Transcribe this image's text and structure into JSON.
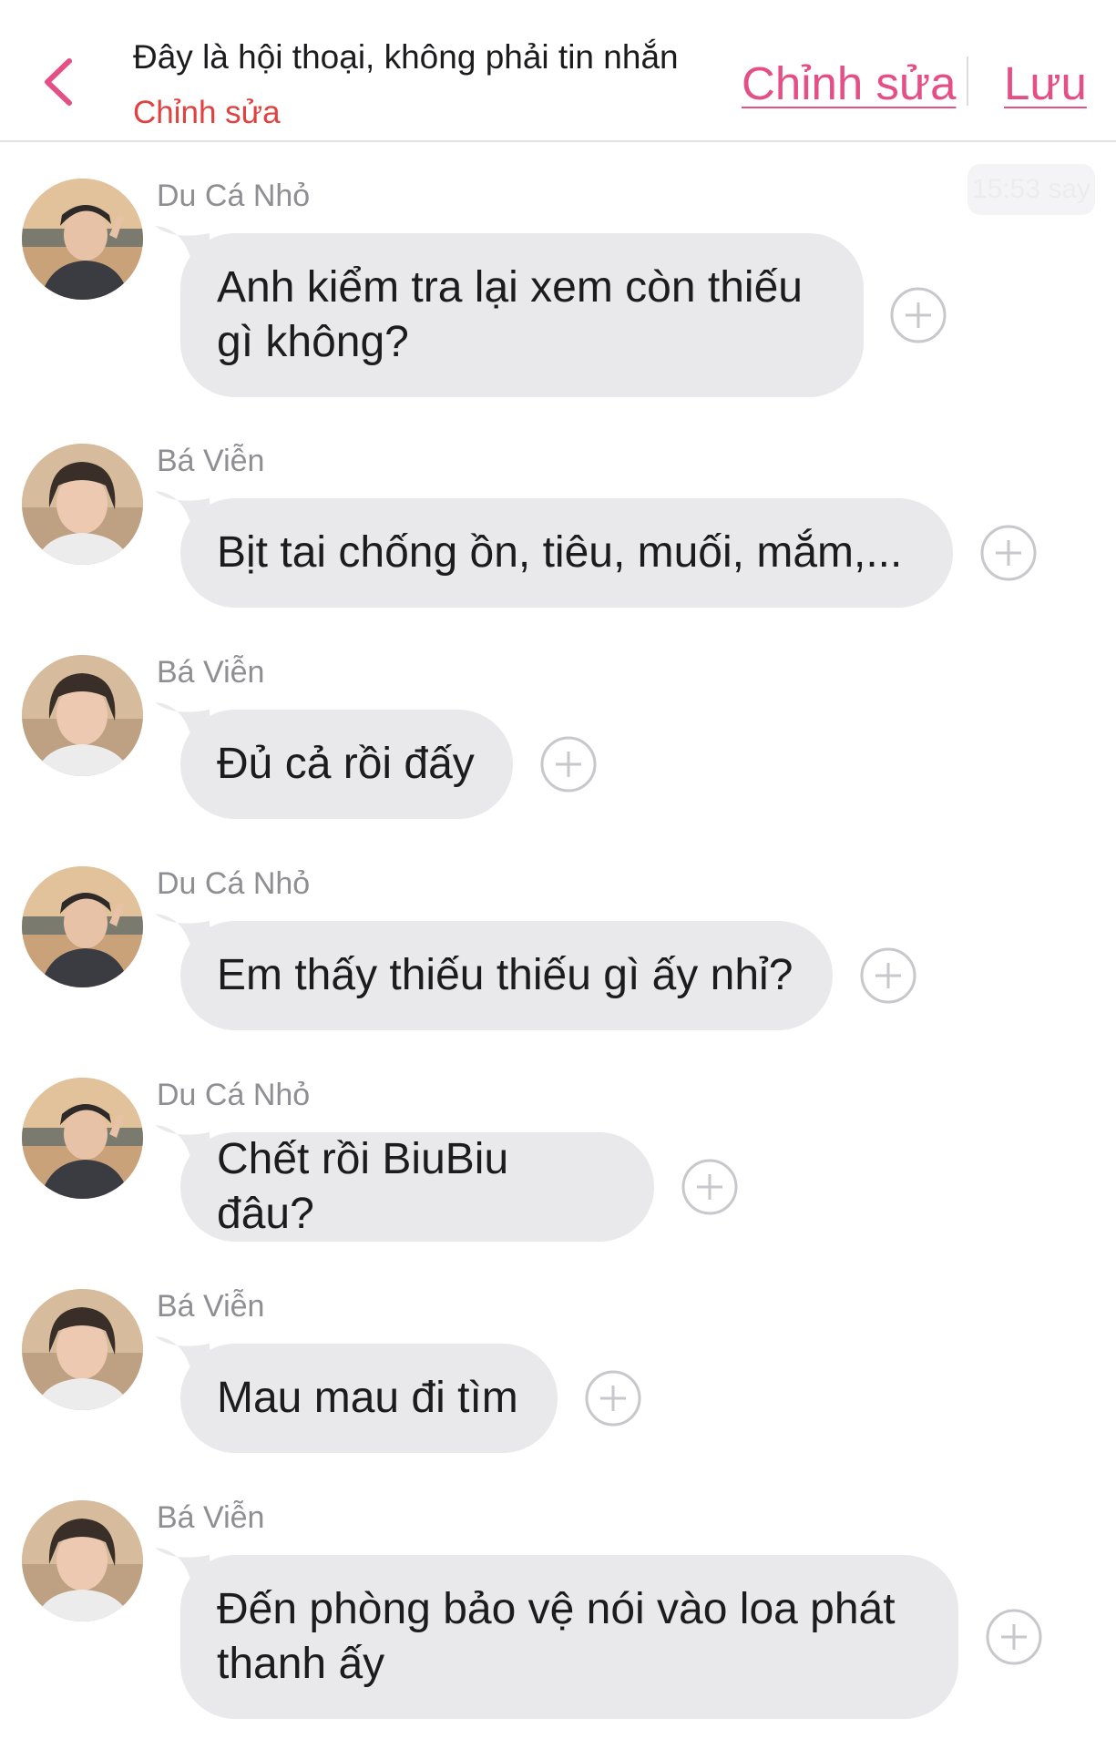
{
  "header": {
    "title": "Đây là hội thoại, không phải tin nhắn",
    "subtitle": "Chỉnh sửa",
    "edit_label": "Chỉnh sửa",
    "save_label": "Lưu",
    "timestamp": "15:53 say"
  },
  "messages": [
    {
      "sender": "Du Cá Nhỏ",
      "text": "Anh kiểm tra lại xem còn thiếu gì không?"
    },
    {
      "sender": "Bá Viễn",
      "text": "Bịt tai chống ồn, tiêu, muối, mắm,..."
    },
    {
      "sender": "Bá Viễn",
      "text": "Đủ cả rồi đấy"
    },
    {
      "sender": "Du Cá Nhỏ",
      "text": "Em thấy thiếu thiếu gì ấy nhỉ?"
    },
    {
      "sender": "Du Cá Nhỏ",
      "text": "Chết rồi BiuBiu đâu?"
    },
    {
      "sender": "Bá Viễn",
      "text": "Mau mau đi tìm"
    },
    {
      "sender": "Bá Viễn",
      "text": "Đến phòng bảo vệ nói vào loa phát thanh ấy"
    }
  ],
  "colors": {
    "accent": "#e44f86",
    "subtitle": "#e0423f",
    "bubble": "#e9e9ec"
  }
}
